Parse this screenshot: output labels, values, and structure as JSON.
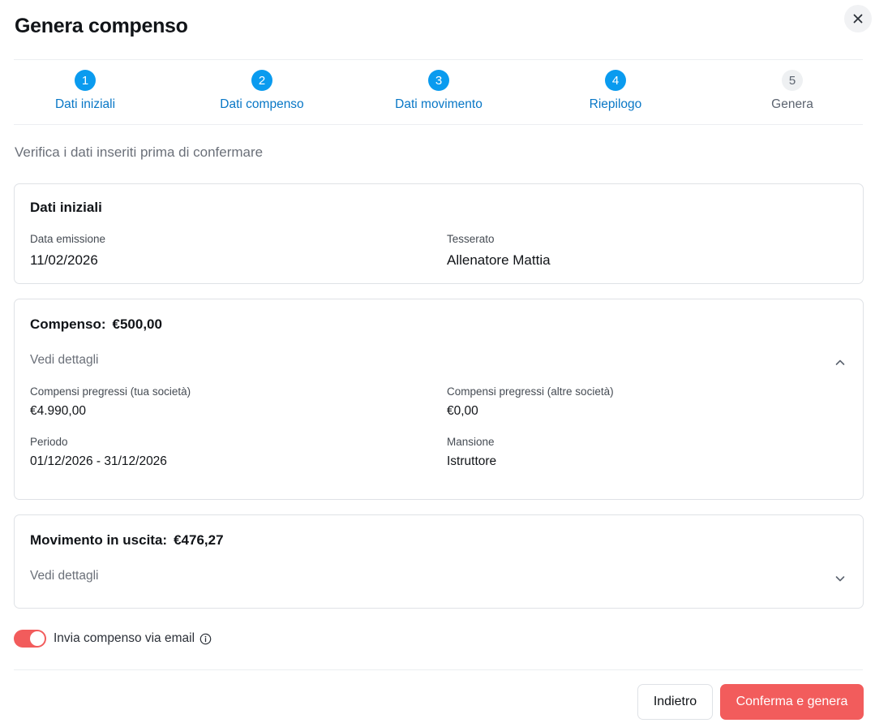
{
  "modal": {
    "title": "Genera compenso"
  },
  "stepper": {
    "steps": [
      {
        "number": "1",
        "label": "Dati iniziali",
        "state": "done"
      },
      {
        "number": "2",
        "label": "Dati compenso",
        "state": "done"
      },
      {
        "number": "3",
        "label": "Dati movimento",
        "state": "done"
      },
      {
        "number": "4",
        "label": "Riepilogo",
        "state": "current"
      },
      {
        "number": "5",
        "label": "Genera",
        "state": "pending"
      }
    ]
  },
  "subtitle": "Verifica i dati inseriti prima di confermare",
  "dati_iniziali": {
    "title": "Dati iniziali",
    "data_emissione_label": "Data emissione",
    "data_emissione_value": "11/02/2026",
    "tesserato_label": "Tesserato",
    "tesserato_value": "Allenatore Mattia"
  },
  "compenso": {
    "title": "Compenso:",
    "amount": "€500,00",
    "details_label": "Vedi dettagli",
    "expanded": true,
    "pregressi_tua_label": "Compensi pregressi (tua società)",
    "pregressi_tua_value": "€4.990,00",
    "pregressi_altre_label": "Compensi pregressi (altre società)",
    "pregressi_altre_value": "€0,00",
    "periodo_label": "Periodo",
    "periodo_value": "01/12/2026 - 31/12/2026",
    "mansione_label": "Mansione",
    "mansione_value": "Istruttore"
  },
  "movimento": {
    "title": "Movimento in uscita:",
    "amount": "€476,27",
    "details_label": "Vedi dettagli",
    "expanded": false
  },
  "email_toggle": {
    "label": "Invia compenso via email",
    "enabled": true
  },
  "footer": {
    "back_label": "Indietro",
    "confirm_label": "Conferma e genera"
  },
  "colors": {
    "primary_blue": "#0a9bef",
    "accent_red": "#f25c5c"
  },
  "icons": {
    "close": "close-icon",
    "chevron_up": "chevron-up-icon",
    "chevron_down": "chevron-down-icon",
    "info": "info-icon"
  }
}
